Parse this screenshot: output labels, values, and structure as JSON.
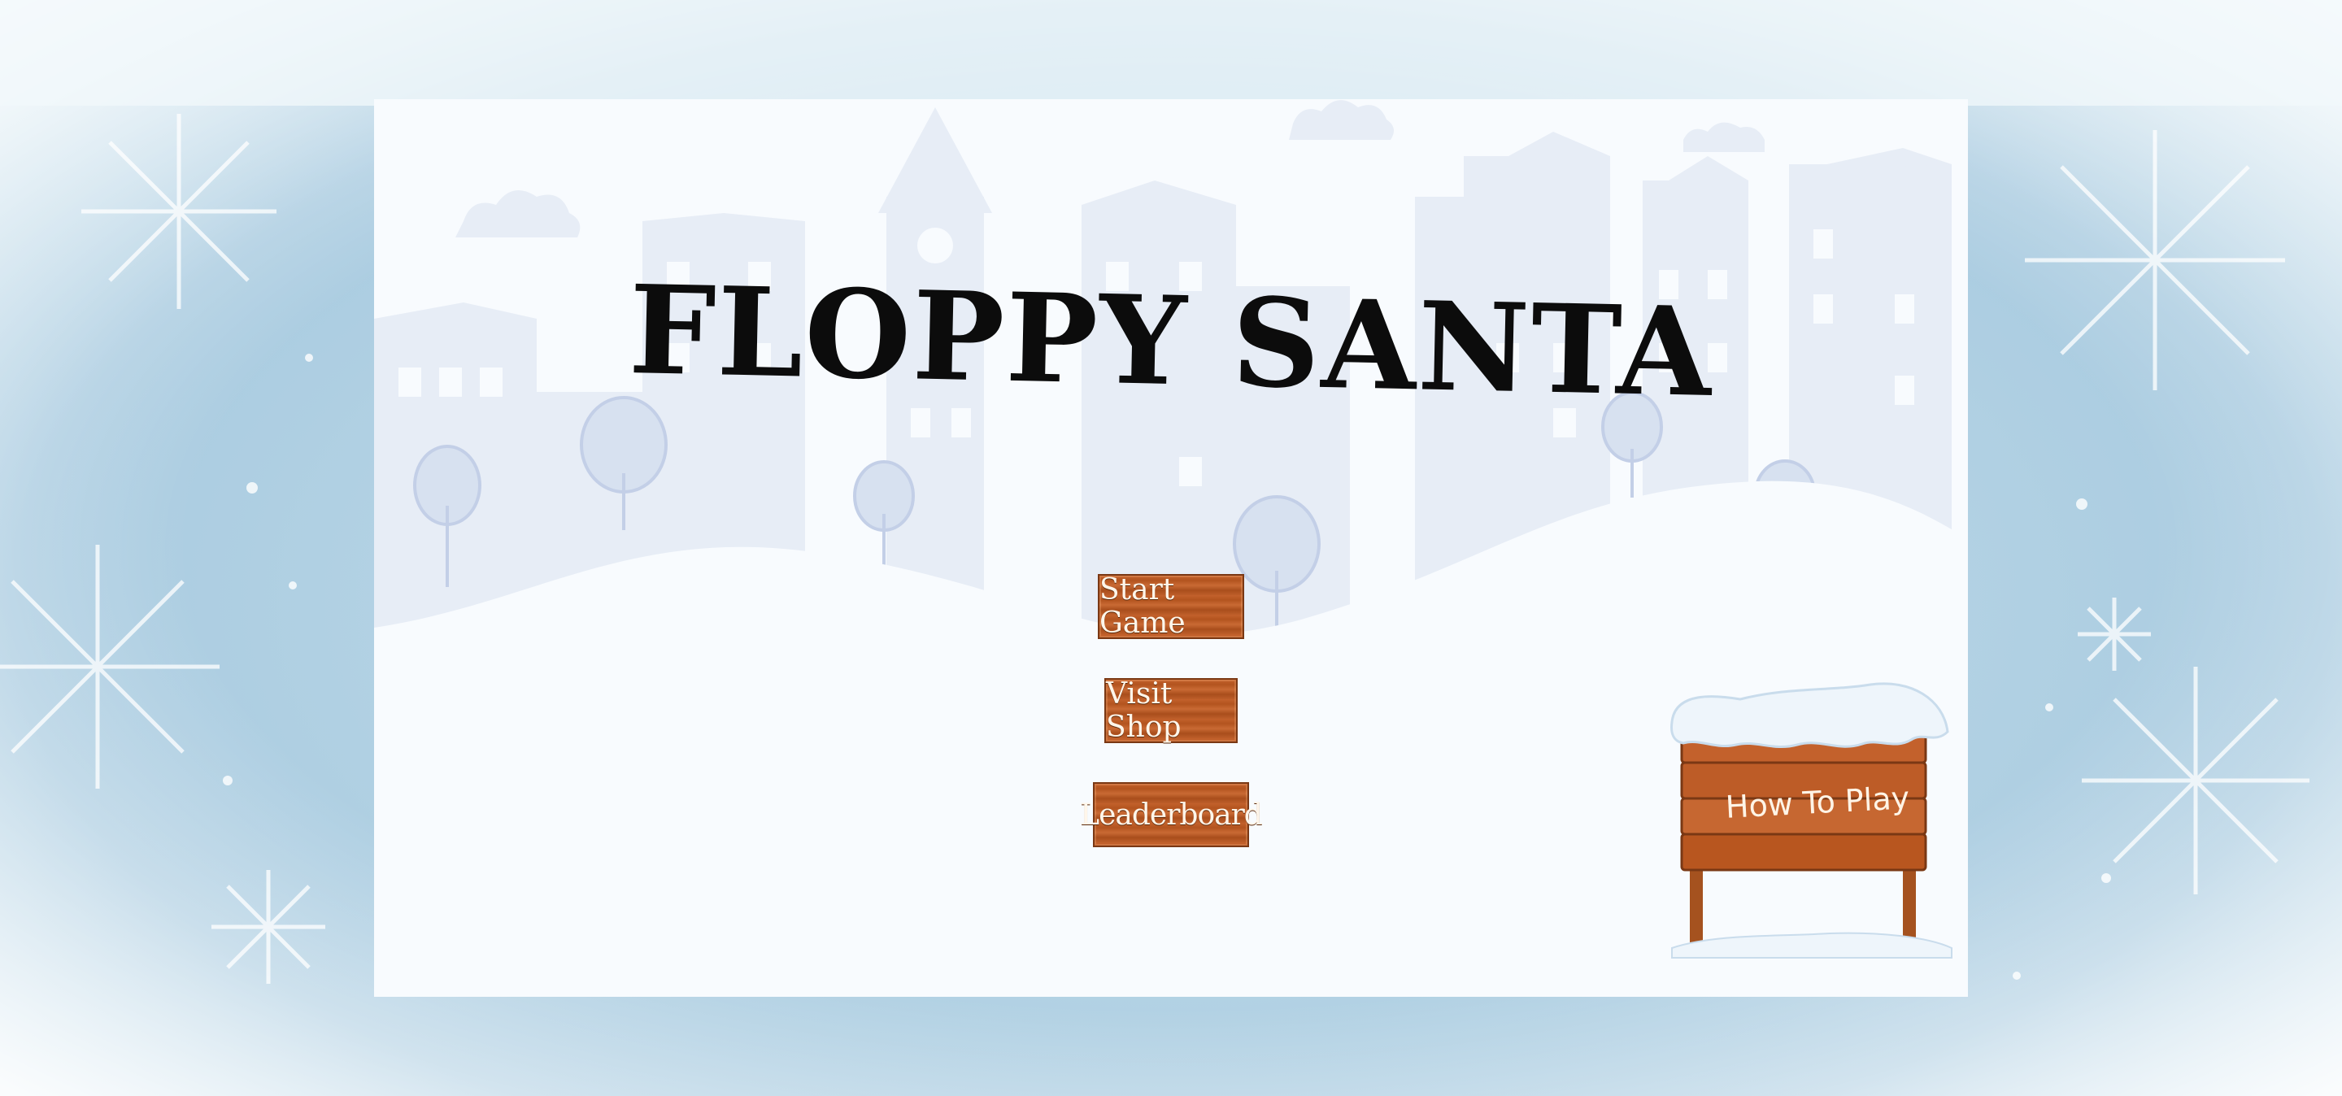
{
  "game": {
    "title": "FLOPPY SANTA",
    "menu": {
      "start_label": "Start Game",
      "shop_label": "Visit Shop",
      "leaderboard_label": "Leaderboard"
    },
    "how_to_play_label": "How To Play"
  },
  "colors": {
    "wood": "#c3612c",
    "snow": "#f8fbfe",
    "buildings": "#e6ecf6",
    "frame": "#b3d2e4"
  }
}
